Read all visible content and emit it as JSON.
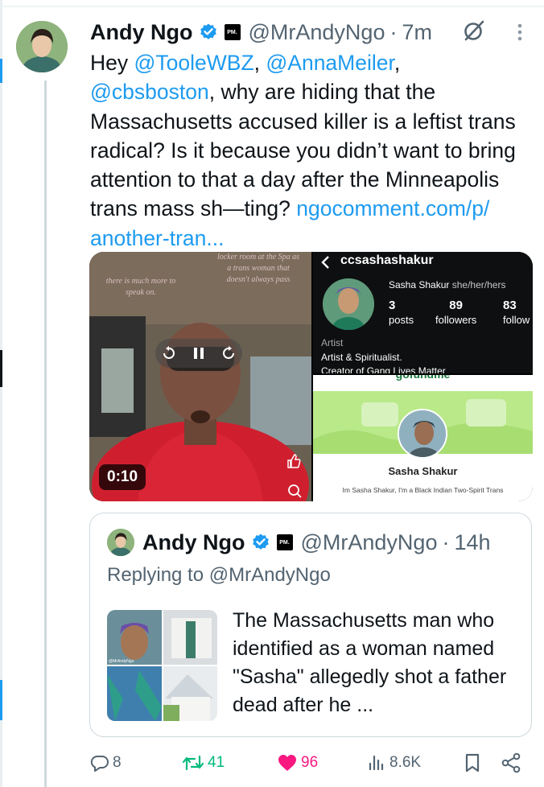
{
  "tweet": {
    "author_name": "Andy Ngo",
    "badge_label": "PM.",
    "handle": "@MrAndyNgo",
    "separator": "·",
    "time": "7m",
    "text_intro": "Hey ",
    "mention1": "@TooleWBZ",
    "sep1": ", ",
    "mention2": "@AnnaMeiler",
    "sep2": ", ",
    "mention3": "@cbsboston",
    "text_body": ", why are hiding that the Massachusetts accused killer is a leftist trans radical? Is it because you didn’t want to bring attention to that a day after the Minneapolis trans mass sh—ting? ",
    "link_text": "ngocomment.com/p/ another-tran..."
  },
  "media": {
    "video": {
      "overlay_left": "there is much more to speak on.",
      "overlay_right": "locker room at the Spa as a trans woman that doesn't always pass",
      "duration": "0:10"
    },
    "instagram": {
      "username": "ccsashashakur",
      "display_name": "Sasha Shakur",
      "pronouns": "she/her/hers",
      "posts_count": "3",
      "posts_label": "posts",
      "followers_count": "89",
      "followers_label": "followers",
      "following_count": "83",
      "following_label": "follow",
      "category": "Artist",
      "bio_line1": "Artist & Spiritualist.",
      "bio_line2": "Creator of Gang Lives Matter"
    },
    "gofundme": {
      "header_partial": "gofundme",
      "name": "Sasha Shakur",
      "bio": "Im Sasha Shakur, I'm a Black Indian Two-Spirit Trans"
    }
  },
  "quote": {
    "author_name": "Andy Ngo",
    "badge_label": "PM.",
    "handle": "@MrAndyNgo",
    "separator": "·",
    "time": "14h",
    "replying_to": "Replying to @MrAndyNgo",
    "thumb_watermark": "@MrAndyNgo",
    "text": "The Massachusetts man who identified as a woman named \"Sasha\" allegedly shot a father dead after he ..."
  },
  "actions": {
    "replies": "8",
    "reposts": "41",
    "likes": "96",
    "views": "8.6K"
  },
  "colors": {
    "link": "#1d9bf0",
    "repost": "#00ba7c",
    "like": "#f91880",
    "secondary_text": "#536471"
  }
}
